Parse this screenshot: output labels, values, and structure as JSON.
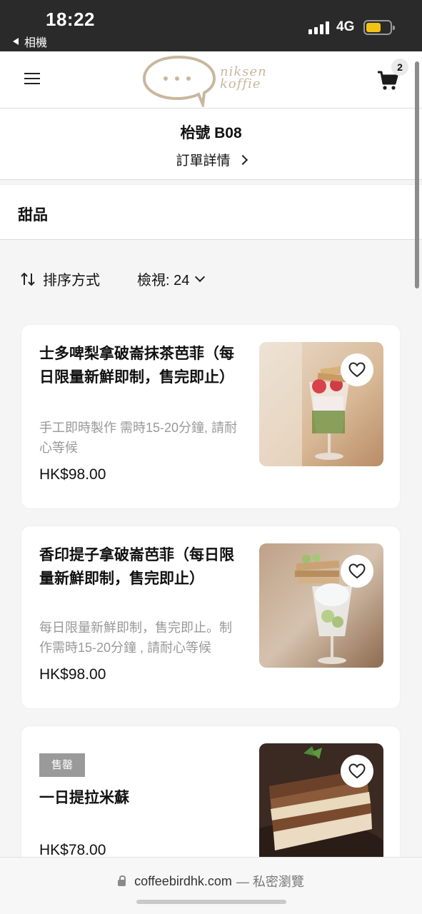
{
  "status_bar": {
    "time": "18:22",
    "back_app": "相機",
    "network": "4G"
  },
  "header": {
    "logo_line1": "niksen",
    "logo_line2": "koffie",
    "cart_count": "2"
  },
  "table_info": {
    "table_label": "枱號 B08",
    "order_detail": "訂單詳情"
  },
  "category": {
    "title": "甜品"
  },
  "toolbar": {
    "sort_label": "排序方式",
    "view_label": "檢視: 24"
  },
  "products": [
    {
      "title": "士多啤梨拿破崙抹茶芭菲（每日限量新鮮即制，售完即止）",
      "desc": "手工即時製作 需時15-20分鐘, 請耐心等候",
      "price": "HK$98.00",
      "image": "strawberry-matcha-parfait"
    },
    {
      "title": "香印提子拿破崙芭菲（每日限量新鮮即制，售完即止）",
      "desc": "每日限量新鮮即制，售完即止。制作需時15-20分鐘 , 請耐心等候",
      "price": "HK$98.00",
      "image": "grape-parfait"
    },
    {
      "badge": "售罄",
      "title": "一日提拉米蘇",
      "price": "HK$78.00",
      "image": "tiramisu"
    }
  ],
  "urlbar": {
    "domain": "coffeebirdhk.com",
    "mode": "— 私密瀏覽"
  },
  "colors": {
    "status_bg": "#2a2a2a",
    "accent_logo": "#c9b79e",
    "battery": "#f2c314",
    "muted_text": "#999999"
  }
}
